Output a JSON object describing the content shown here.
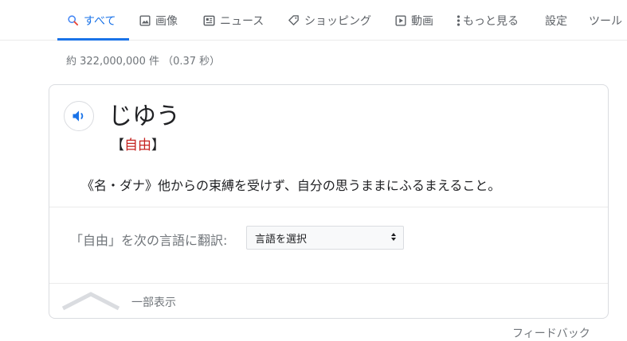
{
  "tabs": [
    {
      "label": "すべて",
      "icon": "search-icon",
      "active": true
    },
    {
      "label": "画像",
      "icon": "image-icon"
    },
    {
      "label": "ニュース",
      "icon": "news-icon"
    },
    {
      "label": "ショッピング",
      "icon": "tag-icon"
    },
    {
      "label": "動画",
      "icon": "play-icon"
    },
    {
      "label": "もっと見る",
      "icon": "more-vert-icon"
    },
    {
      "label": "設定"
    },
    {
      "label": "ツール"
    }
  ],
  "result_stats": "約 322,000,000 件 （0.37 秒）",
  "dictionary": {
    "headword": "じゆう",
    "kanji_open": "【",
    "kanji": "自由",
    "kanji_close": "】",
    "definition": "《名・ダナ》他からの束縛を受けず、自分の思うままにふるまえること。",
    "translate_label": "「自由」を次の言語に翻訳:",
    "language_select": "言語を選択",
    "collapse_label": "一部表示"
  },
  "feedback_label": "フィードバック",
  "colors": {
    "accent": "#1a73e8",
    "kanji_red": "#c5221f",
    "muted_text": "#70757a",
    "border": "#dadce0"
  }
}
